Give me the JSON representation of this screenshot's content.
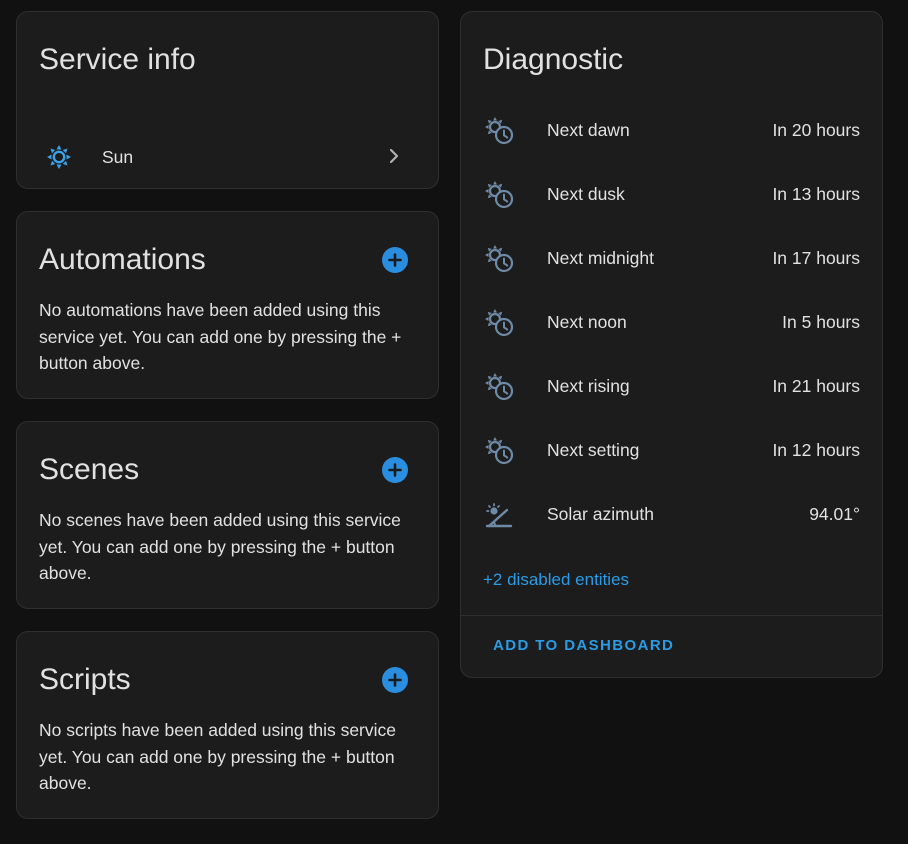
{
  "service_info": {
    "title": "Service info",
    "item_label": "Sun"
  },
  "automations": {
    "title": "Automations",
    "description": "No automations have been added using this service yet. You can add one by pressing the + button above."
  },
  "scenes": {
    "title": "Scenes",
    "description": "No scenes have been added using this service yet. You can add one by pressing the + button above."
  },
  "scripts": {
    "title": "Scripts",
    "description": "No scripts have been added using this service yet. You can add one by pressing the + button above."
  },
  "diagnostic": {
    "title": "Diagnostic",
    "entities": [
      {
        "name": "Next dawn",
        "value": "In 20 hours",
        "icon": "sun-clock-icon"
      },
      {
        "name": "Next dusk",
        "value": "In 13 hours",
        "icon": "sun-clock-icon"
      },
      {
        "name": "Next midnight",
        "value": "In 17 hours",
        "icon": "sun-clock-icon"
      },
      {
        "name": "Next noon",
        "value": "In 5 hours",
        "icon": "sun-clock-icon"
      },
      {
        "name": "Next rising",
        "value": "In 21 hours",
        "icon": "sun-clock-icon"
      },
      {
        "name": "Next setting",
        "value": "In 12 hours",
        "icon": "sun-clock-icon"
      },
      {
        "name": "Solar azimuth",
        "value": "94.01°",
        "icon": "sun-angle-icon"
      }
    ],
    "disabled_link": "+2 disabled entities",
    "add_button": "ADD TO DASHBOARD"
  },
  "colors": {
    "background": "#111111",
    "card": "#1c1c1c",
    "accent": "#2a9be6",
    "icon_muted": "#6f8aa6"
  }
}
